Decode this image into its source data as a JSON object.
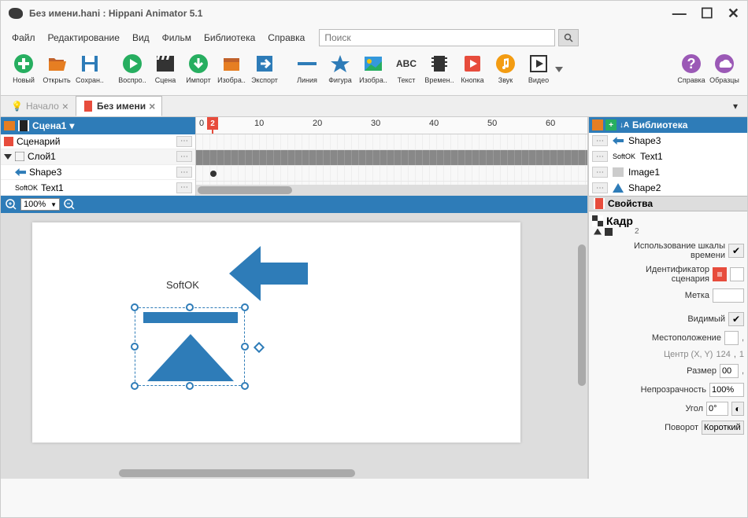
{
  "title": "Без имени.hani : Hippani Animator 5.1",
  "menu": {
    "file": "Файл",
    "edit": "Редактирование",
    "view": "Вид",
    "movie": "Фильм",
    "library": "Библиотека",
    "help": "Справка"
  },
  "search": {
    "placeholder": "Поиск"
  },
  "tools": {
    "new": "Новый",
    "open": "Открыть",
    "save": "Сохран..",
    "play": "Воспро..",
    "scene": "Сцена",
    "import": "Импорт",
    "image": "Изобра..",
    "export": "Экспорт",
    "line": "Линия",
    "shape": "Фигура",
    "picture": "Изобра..",
    "text": "Текст",
    "time": "Времен..",
    "button": "Кнопка",
    "sound": "Звук",
    "video": "Видео",
    "helpbtn": "Справка",
    "samples": "Образцы"
  },
  "tabs": {
    "start": "Начало",
    "untitled": "Без имени"
  },
  "scene": {
    "label": "Сцена1"
  },
  "layers": {
    "scenario": "Сценарий",
    "layer1": "Слой1",
    "shape3": "Shape3",
    "softok": "SoftOK",
    "text1": "Text1"
  },
  "library": {
    "title": "Библиотека",
    "items": {
      "shape3": "Shape3",
      "softok": "SoftOK",
      "text1": "Text1",
      "image1": "Image1",
      "shape2": "Shape2"
    }
  },
  "zoom": {
    "level": "100%"
  },
  "canvas": {
    "softok": "SoftOK"
  },
  "playhead": {
    "frame": "2"
  },
  "ruler": {
    "t0": "0",
    "t10": "10",
    "t20": "20",
    "t30": "30",
    "t40": "40",
    "t50": "50",
    "t60": "60"
  },
  "props": {
    "panel": "Свойства",
    "frame": "Кадр",
    "frame_no": "2",
    "use_timeline": "Использование шкалы времени",
    "scenario_id": "Идентификатор сценария",
    "label": "Метка",
    "visible": "Видимый",
    "position": "Местоположение",
    "center": "Центр (X, Y)",
    "center_x": "124",
    "center_y": "1",
    "size": "Размер",
    "size_v": "00",
    "opacity": "Непрозрачность",
    "opacity_v": "100%",
    "angle": "Угол",
    "angle_v": "0°",
    "rotation": "Поворот",
    "rotation_v": "Короткий"
  }
}
